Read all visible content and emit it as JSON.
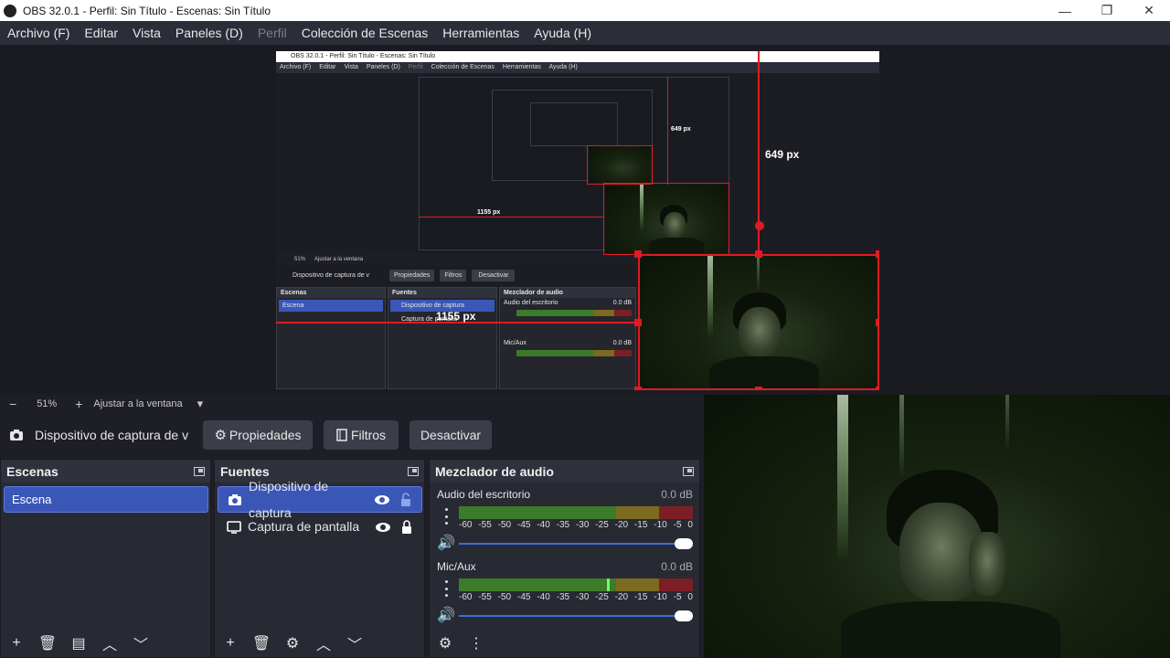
{
  "window": {
    "title": "OBS 32.0.1 - Perfil: Sin Título - Escenas: Sin Título",
    "minimize": "—",
    "maximize": "❐",
    "close": "✕"
  },
  "menu": [
    {
      "label": "Archivo (F)",
      "disabled": false
    },
    {
      "label": "Editar",
      "disabled": false
    },
    {
      "label": "Vista",
      "disabled": false
    },
    {
      "label": "Paneles (D)",
      "disabled": false
    },
    {
      "label": "Perfil",
      "disabled": true
    },
    {
      "label": "Colección de Escenas",
      "disabled": false
    },
    {
      "label": "Herramientas",
      "disabled": false
    },
    {
      "label": "Ayuda (H)",
      "disabled": false
    }
  ],
  "preview": {
    "nested_title": "OBS 32.0.1 - Perfil: Sin Título - Escenas: Sin Título",
    "nested_menu": [
      "Archivo (F)",
      "Editar",
      "Vista",
      "Paneles (D)",
      "Perfil",
      "Colección de Escenas",
      "Herramientas",
      "Ayuda (H)"
    ],
    "nested_zoom": "51%",
    "nested_fit": "Ajustar a la ventana",
    "nested_source": "Dispositivo de captura de v",
    "nested_props": "Propiedades",
    "nested_filters": "Filtros",
    "nested_deactivate": "Desactivar",
    "nested_scenes": "Escenas",
    "nested_sources": "Fuentes",
    "nested_mixer": "Mezclador de audio",
    "nested_scene_item": "Escena",
    "nested_src1": "Dispositivo de captura",
    "nested_src2": "Captura de pantalla",
    "nested_desktop": "Audio del escritorio",
    "nested_mic": "Mic/Aux",
    "nested_db": "0.0 dB",
    "measure_height": "649 px",
    "measure_height_small": "649 px",
    "measure_width": "1155 px",
    "measure_width_small": "1155 px"
  },
  "zoom": {
    "minus": "−",
    "value": "51%",
    "plus": "+",
    "fit": "Ajustar a la ventana",
    "dropdown": "▾"
  },
  "source_bar": {
    "source_name": "Dispositivo de captura de v",
    "properties": "Propiedades",
    "filters": "Filtros",
    "deactivate": "Desactivar"
  },
  "scenes": {
    "title": "Escenas",
    "items": [
      "Escena"
    ]
  },
  "sources": {
    "title": "Fuentes",
    "items": [
      {
        "label": "Dispositivo de captura",
        "icon": "camera-icon",
        "selected": true
      },
      {
        "label": "Captura de pantalla",
        "icon": "monitor-icon",
        "selected": false
      }
    ]
  },
  "mixer": {
    "title": "Mezclador de audio",
    "tracks": [
      {
        "name": "Audio del escritorio",
        "db": "0.0 dB",
        "peak": 0.0
      },
      {
        "name": "Mic/Aux",
        "db": "0.0 dB",
        "peak": 0.64
      }
    ],
    "ticks": [
      "-60",
      "-55",
      "-50",
      "-45",
      "-40",
      "-35",
      "-30",
      "-25",
      "-20",
      "-15",
      "-10",
      "-5",
      "0"
    ]
  }
}
